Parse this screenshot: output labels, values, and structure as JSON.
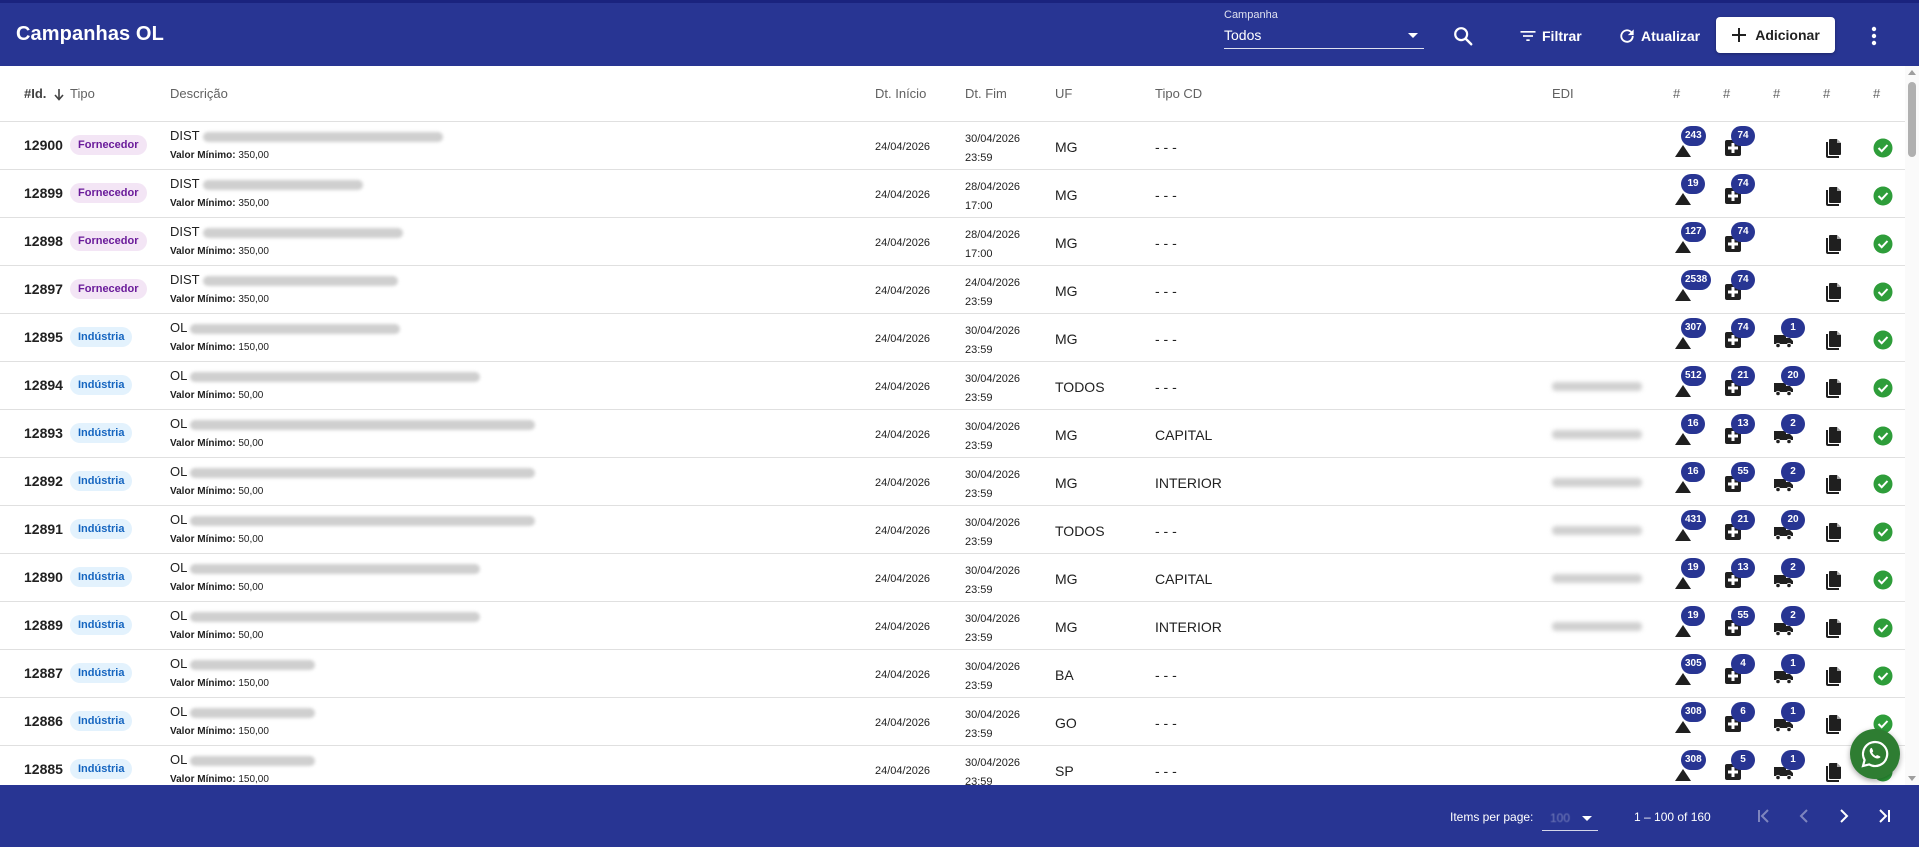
{
  "header": {
    "title": "Campanhas OL",
    "campanha_label": "Campanha",
    "campanha_value": "Todos",
    "filter_label": "Filtrar",
    "refresh_label": "Atualizar",
    "add_label": "Adicionar",
    "icons": {
      "search": "search-icon",
      "filter": "filter-list-icon",
      "refresh": "refresh-icon",
      "add": "plus-icon",
      "more": "more-vert-icon"
    }
  },
  "columns": {
    "id": "#Id.",
    "tipo": "Tipo",
    "descricao": "Descrição",
    "dt_inicio": "Dt. Início",
    "dt_fim": "Dt. Fim",
    "uf": "UF",
    "tipo_cd": "Tipo CD",
    "edi": "EDI",
    "hash": "#"
  },
  "rows": [
    {
      "id": "12900",
      "tipo": "Fornecedor",
      "desc_prefix": "DIST",
      "min_label": "Valor Mínimo:",
      "min_value": "350,00",
      "dt_inicio": "24/04/2026",
      "dt_fim_date": "30/04/2026",
      "dt_fim_time": "23:59",
      "uf": "MG",
      "tipo_cd": "- - -",
      "c1": "243",
      "c2": "74",
      "c3": ""
    },
    {
      "id": "12899",
      "tipo": "Fornecedor",
      "desc_prefix": "DIST",
      "min_label": "Valor Mínimo:",
      "min_value": "350,00",
      "dt_inicio": "24/04/2026",
      "dt_fim_date": "28/04/2026",
      "dt_fim_time": "17:00",
      "uf": "MG",
      "tipo_cd": "- - -",
      "c1": "19",
      "c2": "74",
      "c3": ""
    },
    {
      "id": "12898",
      "tipo": "Fornecedor",
      "desc_prefix": "DIST",
      "min_label": "Valor Mínimo:",
      "min_value": "350,00",
      "dt_inicio": "24/04/2026",
      "dt_fim_date": "28/04/2026",
      "dt_fim_time": "17:00",
      "uf": "MG",
      "tipo_cd": "- - -",
      "c1": "127",
      "c2": "74",
      "c3": ""
    },
    {
      "id": "12897",
      "tipo": "Fornecedor",
      "desc_prefix": "DIST",
      "min_label": "Valor Mínimo:",
      "min_value": "350,00",
      "dt_inicio": "24/04/2026",
      "dt_fim_date": "24/04/2026",
      "dt_fim_time": "23:59",
      "uf": "MG",
      "tipo_cd": "- - -",
      "c1": "2538",
      "c2": "74",
      "c3": ""
    },
    {
      "id": "12895",
      "tipo": "Indústria",
      "desc_prefix": "OL",
      "min_label": "Valor Mínimo:",
      "min_value": "150,00",
      "dt_inicio": "24/04/2026",
      "dt_fim_date": "30/04/2026",
      "dt_fim_time": "23:59",
      "uf": "MG",
      "tipo_cd": "- - -",
      "c1": "307",
      "c2": "74",
      "c3": "1"
    },
    {
      "id": "12894",
      "tipo": "Indústria",
      "desc_prefix": "OL",
      "min_label": "Valor Mínimo:",
      "min_value": "50,00",
      "dt_inicio": "24/04/2026",
      "dt_fim_date": "30/04/2026",
      "dt_fim_time": "23:59",
      "uf": "TODOS",
      "tipo_cd": "- - -",
      "c1": "512",
      "c2": "21",
      "c3": "20"
    },
    {
      "id": "12893",
      "tipo": "Indústria",
      "desc_prefix": "OL",
      "min_label": "Valor Mínimo:",
      "min_value": "50,00",
      "dt_inicio": "24/04/2026",
      "dt_fim_date": "30/04/2026",
      "dt_fim_time": "23:59",
      "uf": "MG",
      "tipo_cd": "CAPITAL",
      "c1": "16",
      "c2": "13",
      "c3": "2"
    },
    {
      "id": "12892",
      "tipo": "Indústria",
      "desc_prefix": "OL",
      "min_label": "Valor Mínimo:",
      "min_value": "50,00",
      "dt_inicio": "24/04/2026",
      "dt_fim_date": "30/04/2026",
      "dt_fim_time": "23:59",
      "uf": "MG",
      "tipo_cd": "INTERIOR",
      "c1": "16",
      "c2": "55",
      "c3": "2"
    },
    {
      "id": "12891",
      "tipo": "Indústria",
      "desc_prefix": "OL",
      "min_label": "Valor Mínimo:",
      "min_value": "50,00",
      "dt_inicio": "24/04/2026",
      "dt_fim_date": "30/04/2026",
      "dt_fim_time": "23:59",
      "uf": "TODOS",
      "tipo_cd": "- - -",
      "c1": "431",
      "c2": "21",
      "c3": "20"
    },
    {
      "id": "12890",
      "tipo": "Indústria",
      "desc_prefix": "OL",
      "min_label": "Valor Mínimo:",
      "min_value": "50,00",
      "dt_inicio": "24/04/2026",
      "dt_fim_date": "30/04/2026",
      "dt_fim_time": "23:59",
      "uf": "MG",
      "tipo_cd": "CAPITAL",
      "c1": "19",
      "c2": "13",
      "c3": "2"
    },
    {
      "id": "12889",
      "tipo": "Indústria",
      "desc_prefix": "OL",
      "min_label": "Valor Mínimo:",
      "min_value": "50,00",
      "dt_inicio": "24/04/2026",
      "dt_fim_date": "30/04/2026",
      "dt_fim_time": "23:59",
      "uf": "MG",
      "tipo_cd": "INTERIOR",
      "c1": "19",
      "c2": "55",
      "c3": "2"
    },
    {
      "id": "12887",
      "tipo": "Indústria",
      "desc_prefix": "OL",
      "min_label": "Valor Mínimo:",
      "min_value": "150,00",
      "dt_inicio": "24/04/2026",
      "dt_fim_date": "30/04/2026",
      "dt_fim_time": "23:59",
      "uf": "BA",
      "tipo_cd": "- - -",
      "c1": "305",
      "c2": "4",
      "c3": "1"
    },
    {
      "id": "12886",
      "tipo": "Indústria",
      "desc_prefix": "OL",
      "min_label": "Valor Mínimo:",
      "min_value": "150,00",
      "dt_inicio": "24/04/2026",
      "dt_fim_date": "30/04/2026",
      "dt_fim_time": "23:59",
      "uf": "GO",
      "tipo_cd": "- - -",
      "c1": "308",
      "c2": "6",
      "c3": "1"
    },
    {
      "id": "12885",
      "tipo": "Indústria",
      "desc_prefix": "OL",
      "min_label": "Valor Mínimo:",
      "min_value": "150,00",
      "dt_inicio": "24/04/2026",
      "dt_fim_date": "30/04/2026",
      "dt_fim_time": "23:59",
      "uf": "SP",
      "tipo_cd": "- - -",
      "c1": "308",
      "c2": "5",
      "c3": "1"
    }
  ],
  "footer": {
    "items_per_page_label": "Items per page:",
    "items_per_page_value": "100",
    "range_label": "1 – 100 of 160"
  },
  "colors": {
    "primary": "#283593",
    "fornecedor_chip_bg": "#f3e5f5",
    "fornecedor_chip_text": "#6a1b9a",
    "industria_chip_bg": "#e3f2fd",
    "industria_chip_text": "#1565c0",
    "status_green": "#2e9d3a",
    "whatsapp_green": "#2e7d32"
  }
}
